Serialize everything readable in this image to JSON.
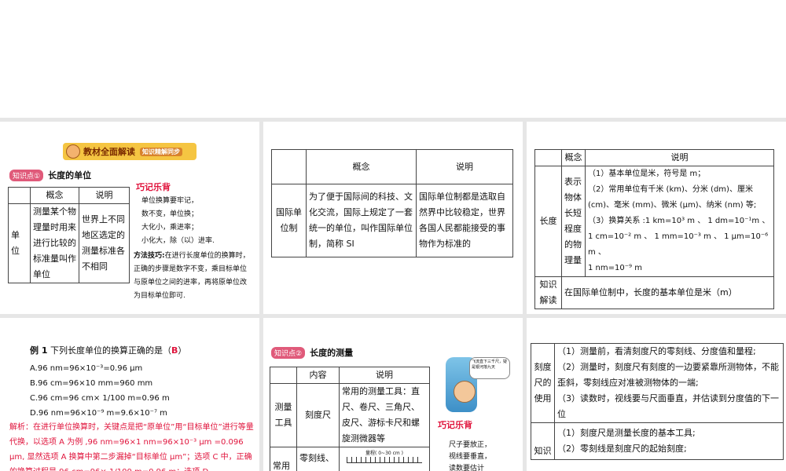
{
  "s1": {
    "banner": "教材全面解读",
    "banner_sub": "知识精解同步",
    "kp_tag": "知识点①",
    "kp_title": "长度的单位",
    "table": {
      "h1": "概念",
      "h2": "说明",
      "row_label": "单位",
      "concept": "测量某个物理量时用来进行比较的标准量叫作单位",
      "desc": "世界上不同地区选定的测量标准各不相同"
    },
    "mnemonic_title": "巧记乐背",
    "mnemonic_lines": [
      "单位换算要牢记，",
      "数不变，单位换；",
      "大化小，乘进率；",
      "小化大，除（以）进率."
    ],
    "tip_label": "方法技巧:",
    "tip_text": "在进行长度单位的换算时，正确的步骤是数字不变，乘目标单位与原单位之间的进率，再将原单位改为目标单位即可."
  },
  "s2": {
    "h1": "概念",
    "h2": "说明",
    "row_label": "国际单位制",
    "concept": "为了便于国际间的科技、文化交流，国际上规定了一套统一的单位，叫作国际单位制，简称 SI",
    "desc": "国际单位制都是选取自然界中比较稳定，世界各国人民都能接受的事物作为标准的"
  },
  "s3": {
    "h1": "概念",
    "h2": "说明",
    "row_label": "长度",
    "concept": "表示物体长短程度的物理量",
    "lines": [
      "（1）基本单位是米，符号是 m；",
      "（2）常用单位有千米 (km)、分米 (dm)、厘米 (cm)、毫米 (mm)、微米 (μm)、纳米 (nm) 等;",
      "（3）换算关系 :1 km=10³ m 、 1 dm=10⁻¹m 、",
      "1 cm=10⁻² m 、 1 mm=10⁻³ m 、 1 μm=10⁻⁶ m 、",
      "1 nm=10⁻⁹ m"
    ],
    "knowledge_label": "知识解读",
    "knowledge_text": "在国际单位制中，长度的基本单位是米（m）"
  },
  "s4": {
    "example_label": "例 1",
    "example_q": "下列长度单位的换算正确的是（",
    "answer": "B",
    "example_close": "）",
    "options": [
      "A.96 nm=96×10⁻³=0.96 μm",
      "B.96 cm=96×10 mm=960 mm",
      "C.96 cm=96 cm× 1/100 m=0.96 m",
      "D.96 nm=96×10⁻⁹ m=9.6×10⁻⁷ m"
    ],
    "analysis": "解析：在进行单位换算时，关键点是把“原单位”用“目标单位”进行等量代换，以选项 A 为例 ,96 nm=96×1 nm=96×10⁻³ μm =0.096 μm, 显然选项 A 换算中第二步漏掉“目标单位 μm”；选项 C 中，正确的换算过程是 96 cm=96× 1/100 m=0.96 m；选项 D"
  },
  "s5": {
    "kp_tag": "知识点②",
    "kp_title": "长度的测量",
    "h1": "内容",
    "h2": "说明",
    "row_label": "测量工具",
    "tool": "刻度尺",
    "tool_desc": "常用的测量工具：直尺、卷尺、三角尺、皮尺、游标卡尺和螺旋测微器等",
    "row2_label": "常用",
    "row2_cell": "零刻线、",
    "ruler_caption": "量程( 0~30 cm )",
    "speech": "飞流直下三千尺，疑是银河落九天",
    "mnemonic_title": "巧记乐背",
    "mnemonic_lines": [
      "尺子要放正，",
      "视线要垂直，",
      "读数要估计"
    ]
  },
  "s6": {
    "row_label": "刻度尺的使用",
    "lines": [
      "（1）测量前，看清刻度尺的零刻线、分度值和量程;",
      "（2）测量时，刻度尺有刻度的一边要紧靠所测物体，不能歪斜，零刻线应对准被测物体的一端;",
      "（3）读数时，视线要与尺面垂直，并估读到分度值的下一位"
    ],
    "row2_label": "知识",
    "row2_lines": [
      "（1）刻度尺是测量长度的基本工具;",
      "（2）零刻线是刻度尺的起始刻度;"
    ]
  }
}
